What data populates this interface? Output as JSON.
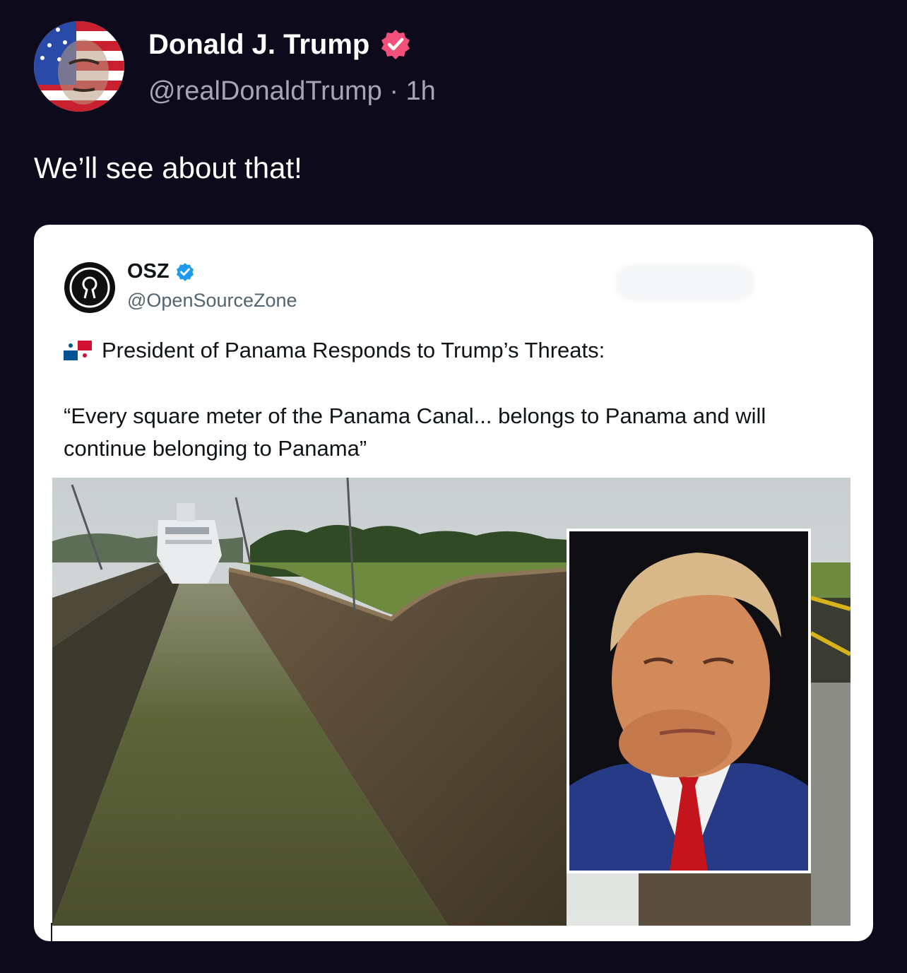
{
  "post": {
    "author_name": "Donald J. Trump",
    "handle": "@realDonaldTrump",
    "separator": "·",
    "time": "1h",
    "text": "We’ll see about that!",
    "verified_color": "#f0507a"
  },
  "embedded": {
    "name": "OSZ",
    "handle": "@OpenSourceZone",
    "verified_color": "#1d9bf0",
    "headline": "President of Panama Responds to Trump’s Threats:",
    "quote": "“Every square meter of the Panama Canal... belongs to Panama and will continue belonging to Panama”",
    "headline_icon": "panama-flag-icon",
    "image": {
      "scene": "panama-canal-locks-with-cruise-ship",
      "inset": "portrait-inset"
    }
  },
  "colors": {
    "background": "#0d0a1b",
    "secondary_text": "#a7a4b6",
    "card": "#ffffff"
  }
}
